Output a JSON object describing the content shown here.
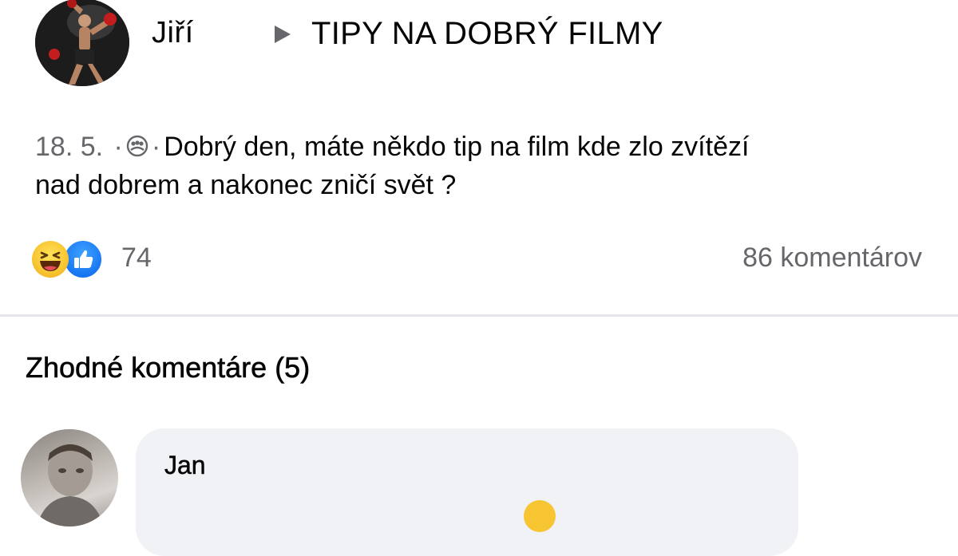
{
  "post": {
    "author": "Jiří",
    "group": "TIPY NA DOBRÝ FILMY",
    "date": "18. 5.",
    "separator": "·",
    "audience_icon": "group-audience-icon",
    "text_line1": "Dobrý den, máte někdo tip na film kde zlo zvítězí",
    "text_line2": "nad dobrem a nakonec zničí svět ?"
  },
  "reactions": {
    "icons": [
      "haha-reaction-icon",
      "like-reaction-icon"
    ],
    "count": "74",
    "comments_label": "86 komentárov"
  },
  "comments": {
    "title": "Zhodné komentáre (5)",
    "first_author": "Jan"
  },
  "colors": {
    "secondary_text": "#65676b",
    "like_blue": "#1877f2",
    "haha_yellow": "#f7c531",
    "bubble_bg": "#f0f2f5",
    "divider": "#e4e6eb"
  }
}
